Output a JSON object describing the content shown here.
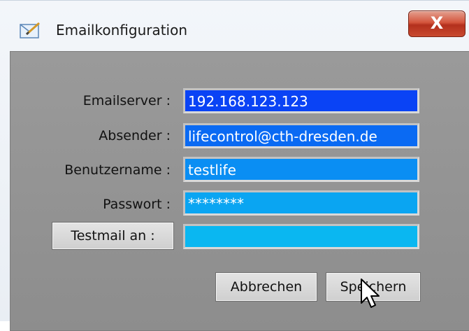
{
  "window": {
    "title": "Emailkonfiguration",
    "close_symbol": "X"
  },
  "form": {
    "fields": [
      {
        "label": "Emailserver :",
        "value": "192.168.123.123",
        "color": "#0a43f5"
      },
      {
        "label": "Absender :",
        "value": "lifecontrol@cth-dresden.de",
        "color": "#0a6af3"
      },
      {
        "label": "Benutzername :",
        "value": "testlife",
        "color": "#0a8ef3"
      },
      {
        "label": "Passwort :",
        "value": "********",
        "color": "#0aa5f2"
      },
      {
        "label": "Testmail an :",
        "value": "",
        "color": "#0ab7f1"
      }
    ],
    "test_button_label": "Testmail an :"
  },
  "actions": {
    "cancel_label": "Abbrechen",
    "save_label": "Speichern"
  },
  "icons": {
    "app": "email-config-icon",
    "close": "close-icon",
    "cursor": "mouse-pointer-icon"
  }
}
